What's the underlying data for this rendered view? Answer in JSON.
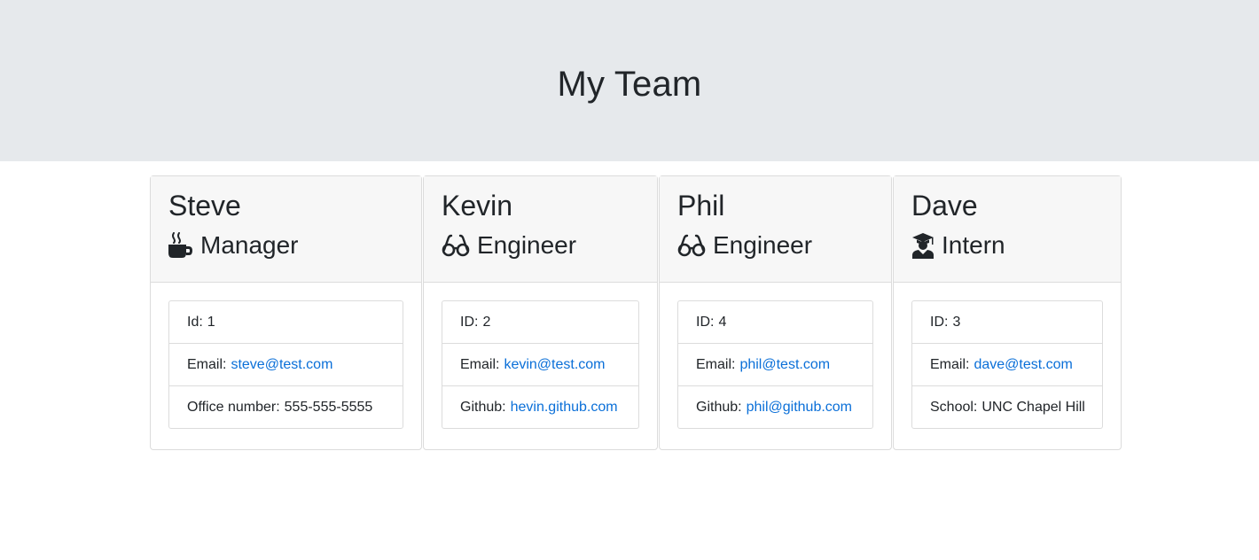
{
  "header": {
    "title": "My Team"
  },
  "team": [
    {
      "name": "Steve",
      "role": "Manager",
      "icon": "coffee-icon",
      "id_label": "Id:",
      "id": "1",
      "email_label": "Email:",
      "email": "steve@test.com",
      "extra_label": "Office number:",
      "extra": "555-555-5555",
      "extra_is_link": false
    },
    {
      "name": "Kevin",
      "role": "Engineer",
      "icon": "glasses-icon",
      "id_label": "ID:",
      "id": "2",
      "email_label": "Email:",
      "email": "kevin@test.com",
      "extra_label": "Github:",
      "extra": "hevin.github.com",
      "extra_is_link": true
    },
    {
      "name": "Phil",
      "role": "Engineer",
      "icon": "glasses-icon",
      "id_label": "ID:",
      "id": "4",
      "email_label": "Email:",
      "email": "phil@test.com",
      "extra_label": "Github:",
      "extra": "phil@github.com",
      "extra_is_link": true
    },
    {
      "name": "Dave",
      "role": "Intern",
      "icon": "graduate-icon",
      "id_label": "ID:",
      "id": "3",
      "email_label": "Email:",
      "email": "dave@test.com",
      "extra_label": "School:",
      "extra": "UNC Chapel Hill",
      "extra_is_link": false
    }
  ],
  "colors": {
    "link": "#0a6fd8",
    "jumbotron_bg": "#e6e9ec",
    "card_header_bg": "#f7f7f7"
  }
}
